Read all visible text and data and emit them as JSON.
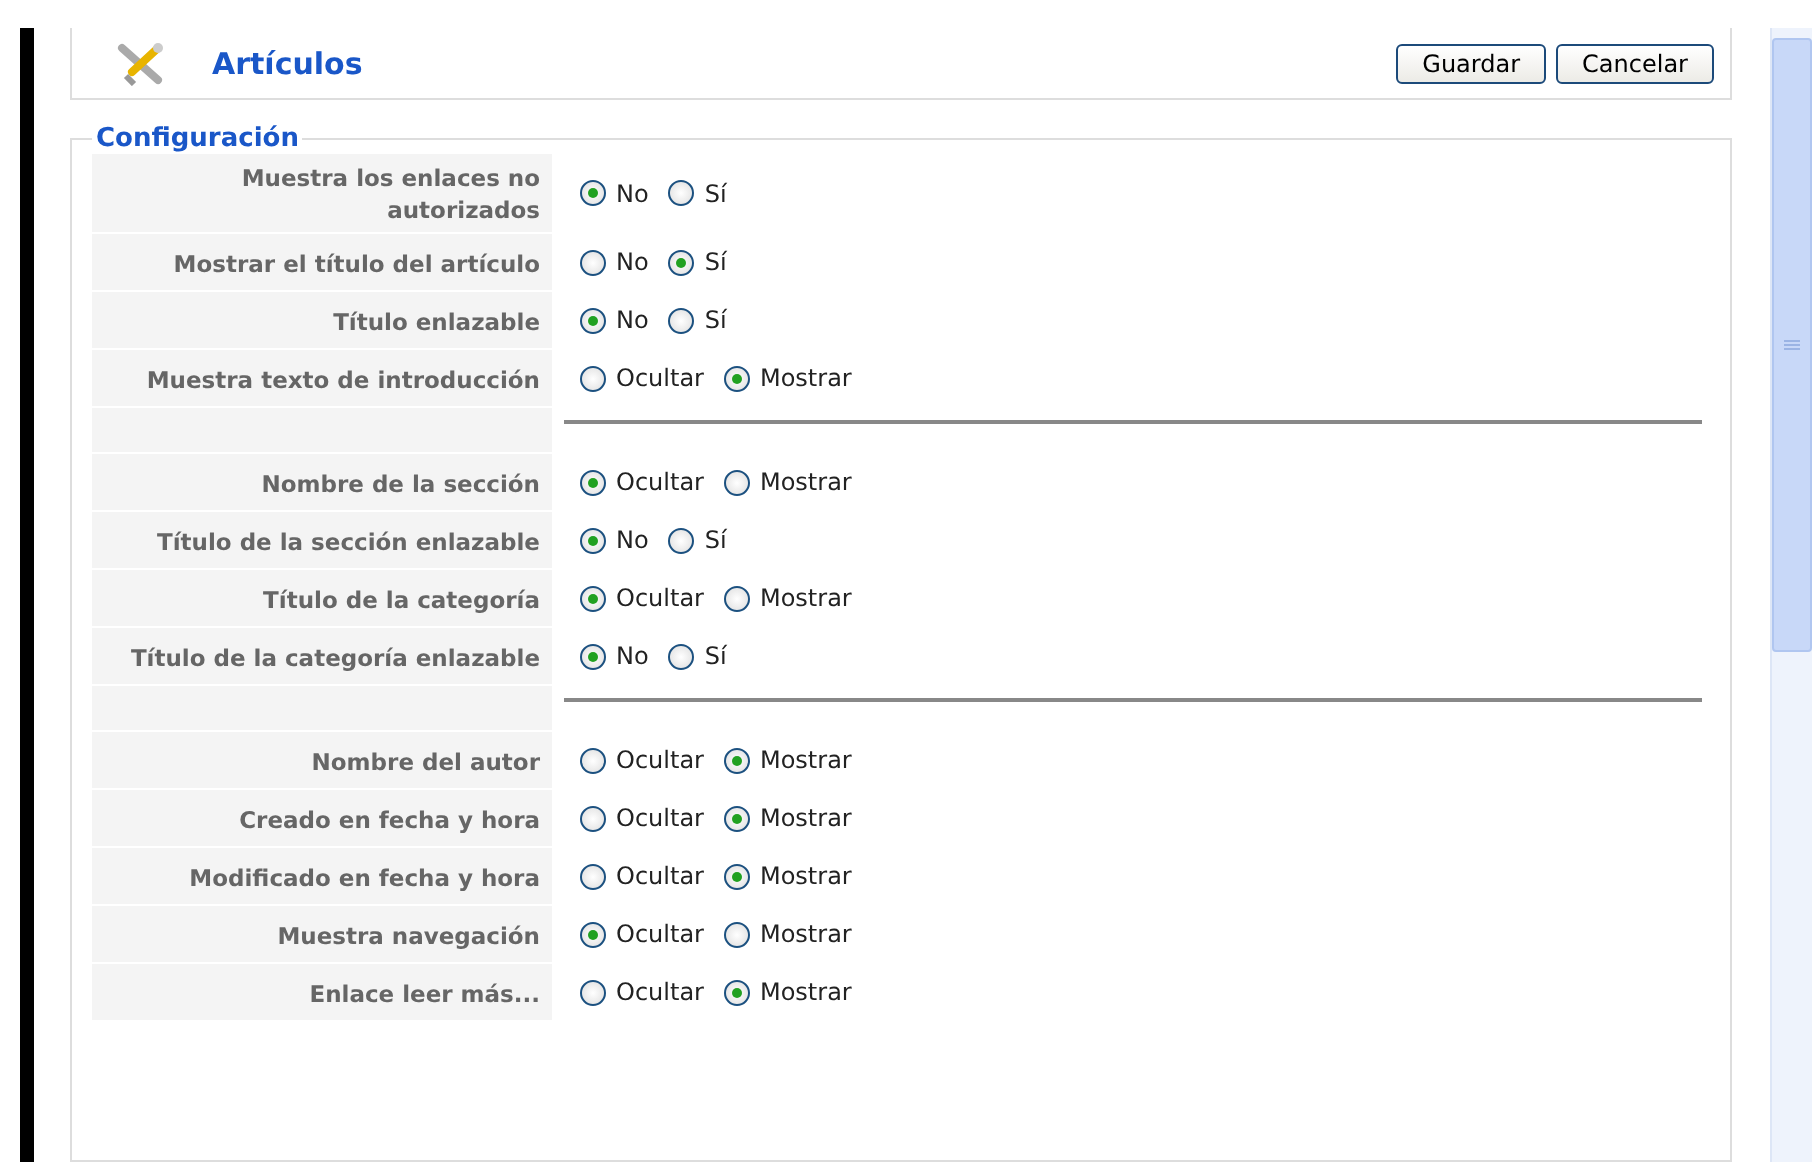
{
  "header": {
    "title": "Artículos",
    "buttons": [
      "Guardar",
      "Cancelar"
    ]
  },
  "config": {
    "legend": "Configuración",
    "rows": [
      {
        "kind": "radio",
        "label": "Muestra los enlaces no autorizados",
        "options": [
          {
            "label": "No",
            "selected": true
          },
          {
            "label": "Sí",
            "selected": false
          }
        ]
      },
      {
        "kind": "radio",
        "label": "Mostrar el título del artículo",
        "options": [
          {
            "label": "No",
            "selected": false
          },
          {
            "label": "Sí",
            "selected": true
          }
        ]
      },
      {
        "kind": "radio",
        "label": "Título enlazable",
        "options": [
          {
            "label": "No",
            "selected": true
          },
          {
            "label": "Sí",
            "selected": false
          }
        ]
      },
      {
        "kind": "radio",
        "label": "Muestra texto de introducción",
        "options": [
          {
            "label": "Ocultar",
            "selected": false
          },
          {
            "label": "Mostrar",
            "selected": true
          }
        ]
      },
      {
        "kind": "separator"
      },
      {
        "kind": "radio",
        "label": "Nombre de la sección",
        "options": [
          {
            "label": "Ocultar",
            "selected": true
          },
          {
            "label": "Mostrar",
            "selected": false
          }
        ]
      },
      {
        "kind": "radio",
        "label": "Título de la sección enlazable",
        "options": [
          {
            "label": "No",
            "selected": true
          },
          {
            "label": "Sí",
            "selected": false
          }
        ]
      },
      {
        "kind": "radio",
        "label": "Título de la categoría",
        "options": [
          {
            "label": "Ocultar",
            "selected": true
          },
          {
            "label": "Mostrar",
            "selected": false
          }
        ]
      },
      {
        "kind": "radio",
        "label": "Título de la categoría enlazable",
        "options": [
          {
            "label": "No",
            "selected": true
          },
          {
            "label": "Sí",
            "selected": false
          }
        ]
      },
      {
        "kind": "separator"
      },
      {
        "kind": "radio",
        "label": "Nombre del autor",
        "options": [
          {
            "label": "Ocultar",
            "selected": false
          },
          {
            "label": "Mostrar",
            "selected": true
          }
        ]
      },
      {
        "kind": "radio",
        "label": "Creado en fecha y hora",
        "options": [
          {
            "label": "Ocultar",
            "selected": false
          },
          {
            "label": "Mostrar",
            "selected": true
          }
        ]
      },
      {
        "kind": "radio",
        "label": "Modificado en fecha y hora",
        "options": [
          {
            "label": "Ocultar",
            "selected": false
          },
          {
            "label": "Mostrar",
            "selected": true
          }
        ]
      },
      {
        "kind": "radio",
        "label": "Muestra navegación",
        "options": [
          {
            "label": "Ocultar",
            "selected": true
          },
          {
            "label": "Mostrar",
            "selected": false
          }
        ]
      },
      {
        "kind": "radio",
        "label": "Enlace leer más...",
        "options": [
          {
            "label": "Ocultar",
            "selected": false
          },
          {
            "label": "Mostrar",
            "selected": true
          }
        ]
      }
    ]
  }
}
